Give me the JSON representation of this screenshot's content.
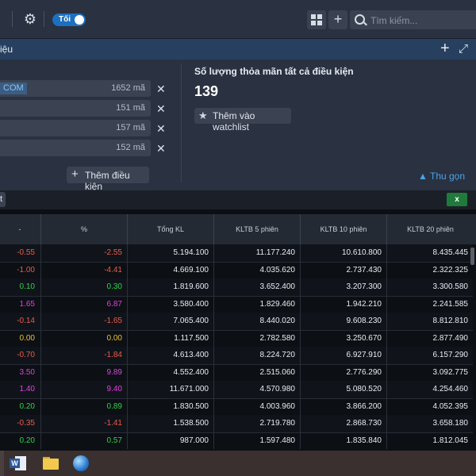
{
  "toolbar": {
    "theme_toggle_label": "Tối",
    "search_placeholder": "Tìm kiếm..."
  },
  "panel": {
    "title_fragment": "iệu"
  },
  "conditions": [
    {
      "name": "COM",
      "count": "1652 mã"
    },
    {
      "name": "",
      "count": "151 mã"
    },
    {
      "name": "",
      "count": "157 mã"
    },
    {
      "name": "",
      "count": "152 mã"
    }
  ],
  "add_condition_label": "Thêm điều kiện",
  "result": {
    "title": "Số lượng thỏa mãn tất cả điều kiện",
    "count": "139",
    "watchlist_label": "Thêm vào watchlist",
    "collapse_label": "Thu gọn"
  },
  "strip": {
    "button_fragment": "t"
  },
  "table": {
    "headers": [
      "-",
      "%",
      "Tổng KL",
      "KLTB 5 phiên",
      "KLTB 10 phiên",
      "KLTB 20 phiên"
    ],
    "rows": [
      [
        "-0.55",
        "-2.55",
        "5.194.100",
        "11.177.240",
        "10.610.800",
        "8.435.445"
      ],
      [
        "-1.00",
        "-4.41",
        "4.669.100",
        "4.035.620",
        "2.737.430",
        "2.322.325"
      ],
      [
        "0.10",
        "0.30",
        "1.819.600",
        "3.652.400",
        "3.207.300",
        "3.300.580"
      ],
      [
        "1.65",
        "6.87",
        "3.580.400",
        "1.829.460",
        "1.942.210",
        "2.241.585"
      ],
      [
        "-0.14",
        "-1.65",
        "7.065.400",
        "8.440.020",
        "9.608.230",
        "8.812.810"
      ],
      [
        "0.00",
        "0.00",
        "1.117.500",
        "2.782.580",
        "3.250.670",
        "2.877.490"
      ],
      [
        "-0.70",
        "-1.84",
        "4.613.400",
        "8.224.720",
        "6.927.910",
        "6.157.290"
      ],
      [
        "3.50",
        "9.89",
        "4.552.400",
        "2.515.060",
        "2.776.290",
        "3.092.775"
      ],
      [
        "1.40",
        "9.40",
        "11.671.000",
        "4.570.980",
        "5.080.520",
        "4.254.460"
      ],
      [
        "0.20",
        "0.89",
        "1.830.500",
        "4.003.960",
        "3.866.200",
        "4.052.395"
      ],
      [
        "-0.35",
        "-1.41",
        "1.538.500",
        "2.719.780",
        "2.868.730",
        "3.658.180"
      ],
      [
        "0.20",
        "0.57",
        "987.000",
        "1.597.480",
        "1.835.840",
        "1.812.045"
      ]
    ],
    "row_colors": [
      "#e85c4a",
      "#e85c4a",
      "#2fd34a",
      "#e040e0",
      "#e85c4a",
      "#e8c22a",
      "#e85c4a",
      "#d14bd6",
      "#e040e0",
      "#2fd34a",
      "#e85c4a",
      "#2fd34a"
    ]
  },
  "colors": {
    "accent": "#4aa3e8",
    "topbar": "#2a3140",
    "panel_header": "#27405f",
    "excel_green": "#1f7a3c"
  },
  "icons": [
    "gear-icon",
    "grid-icon",
    "plus-icon",
    "search-icon",
    "expand-icon",
    "close-icon",
    "star-icon",
    "excel-icon",
    "word-icon",
    "folder-icon",
    "browser-icon"
  ]
}
